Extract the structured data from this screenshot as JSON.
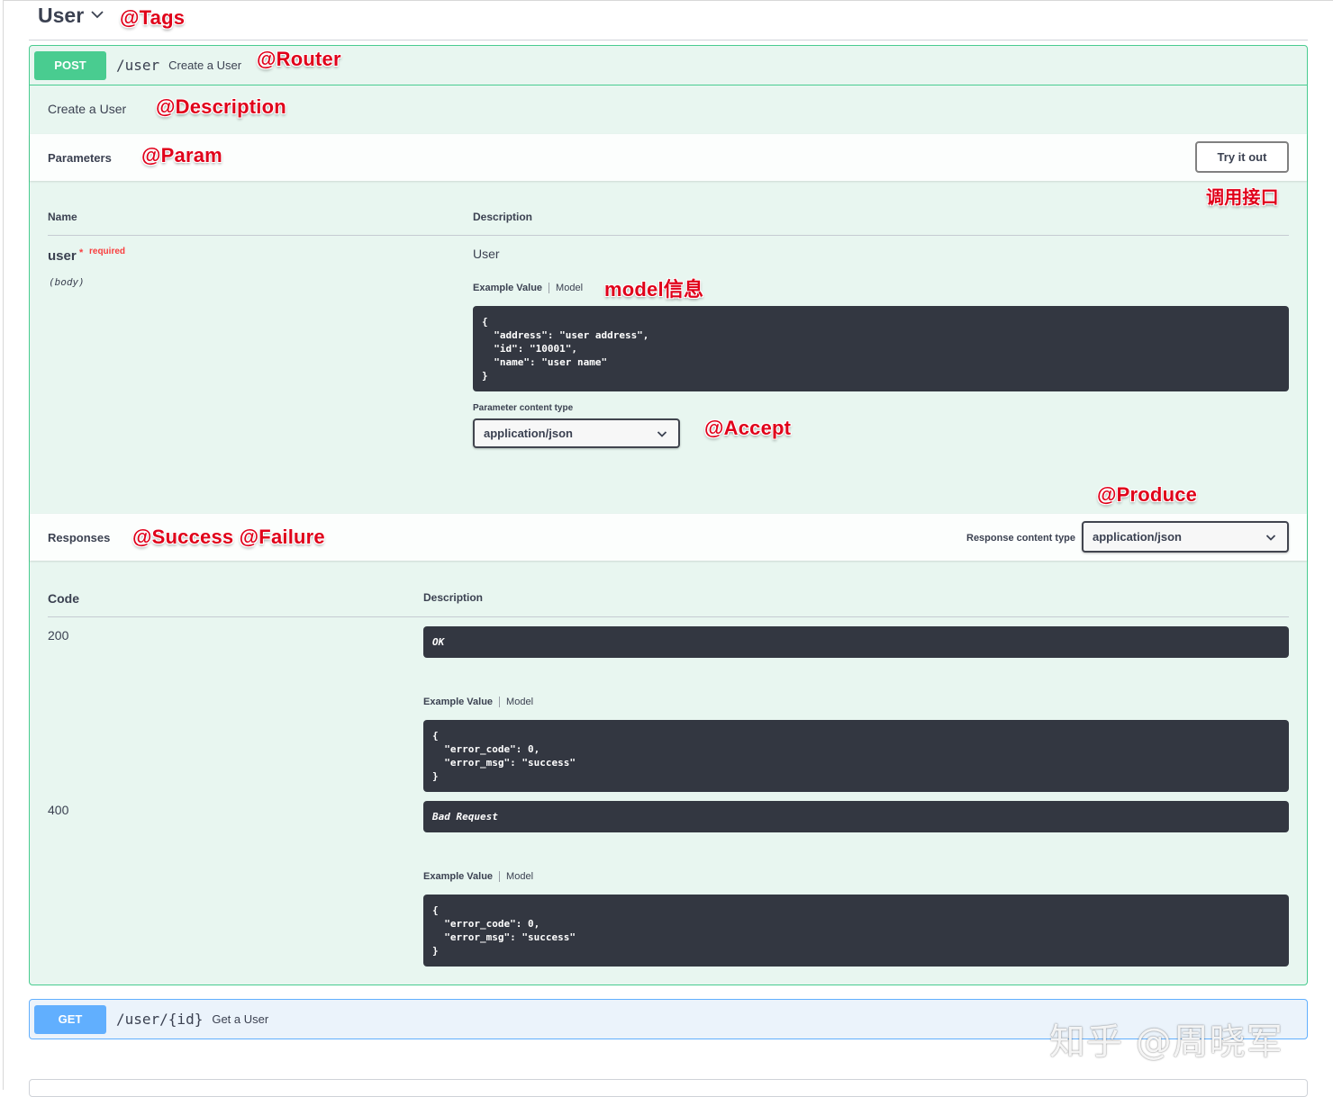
{
  "tag": {
    "title": "User"
  },
  "annotations": {
    "tags": "@Tags",
    "router": "@Router",
    "description": "@Description",
    "param": "@Param",
    "try_api": "调用接口",
    "model_info": "model信息",
    "accept": "@Accept",
    "produce": "@Produce",
    "success_failure": "@Success @Failure"
  },
  "post_op": {
    "method": "POST",
    "path": "/user",
    "summary": "Create a User",
    "description": "Create a User",
    "parameters": {
      "title": "Parameters",
      "try_button": "Try it out",
      "col_name": "Name",
      "col_description": "Description",
      "param": {
        "name": "user",
        "star": "*",
        "required": "required",
        "in": "(body)",
        "type": "User",
        "tab_example": "Example Value",
        "tab_model": "Model",
        "example": "{\n  \"address\": \"user address\",\n  \"id\": \"10001\",\n  \"name\": \"user name\"\n}"
      },
      "content_type_label": "Parameter content type",
      "content_type": "application/json"
    },
    "responses": {
      "title": "Responses",
      "content_type_label": "Response content type",
      "content_type": "application/json",
      "col_code": "Code",
      "col_description": "Description",
      "items": [
        {
          "code": "200",
          "description": "OK",
          "tab_example": "Example Value",
          "tab_model": "Model",
          "example": "{\n  \"error_code\": 0,\n  \"error_msg\": \"success\"\n}"
        },
        {
          "code": "400",
          "description": "Bad Request",
          "tab_example": "Example Value",
          "tab_model": "Model",
          "example": "{\n  \"error_code\": 0,\n  \"error_msg\": \"success\"\n}"
        }
      ]
    }
  },
  "get_op": {
    "method": "GET",
    "path": "/user/{id}",
    "summary": "Get a User"
  },
  "watermark": "知乎 @周晓军",
  "colors": {
    "post": "#49cc90",
    "get": "#61affe",
    "annotation": "#e0001a",
    "code_bg": "#333741"
  }
}
